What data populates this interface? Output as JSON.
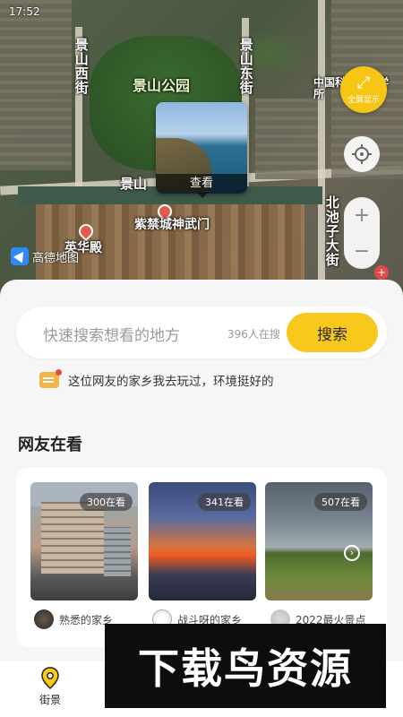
{
  "status": {
    "time": "17:52"
  },
  "map": {
    "labels": {
      "jingshan_west_street": "景山西街",
      "jingshan_east_street": "景山东街",
      "jingshan_park": "景山公园",
      "jingshan_partial": "景山",
      "shenwu_gate": "紫禁城神武门",
      "north_chizi_street": "北池子大街",
      "hall_partial": "英华殿",
      "building_top_right": "中国科学院法学所"
    },
    "preview": {
      "caption": "查看"
    },
    "fullscreen_label": "全屏显示",
    "zoom_in": "+",
    "zoom_out": "−",
    "logo_text": "高德地图"
  },
  "search": {
    "placeholder": "快速搜索想看的地方",
    "count_text": "396人在搜",
    "button": "搜索"
  },
  "tip": {
    "text": "这位网友的家乡我去玩过，环境挺好的"
  },
  "section": {
    "title": "网友在看"
  },
  "cards": [
    {
      "badge": "300在看",
      "author": "熟悉的家乡"
    },
    {
      "badge": "341在看",
      "author": "战斗呀的家乡"
    },
    {
      "badge": "507在看",
      "author": "2022最火景点"
    }
  ],
  "nav": [
    {
      "label": "街景",
      "icon": "location-pin-icon",
      "active": true
    },
    {
      "label": "",
      "icon": "nav-icon-2",
      "active": false
    },
    {
      "label": "",
      "icon": "nav-icon-3",
      "active": false
    },
    {
      "label": "",
      "icon": "nav-icon-4",
      "active": false
    }
  ],
  "watermark": {
    "text": "下载鸟资源"
  },
  "colors": {
    "accent": "#f8c81c",
    "sheet_bg": "#f6f6f6"
  }
}
